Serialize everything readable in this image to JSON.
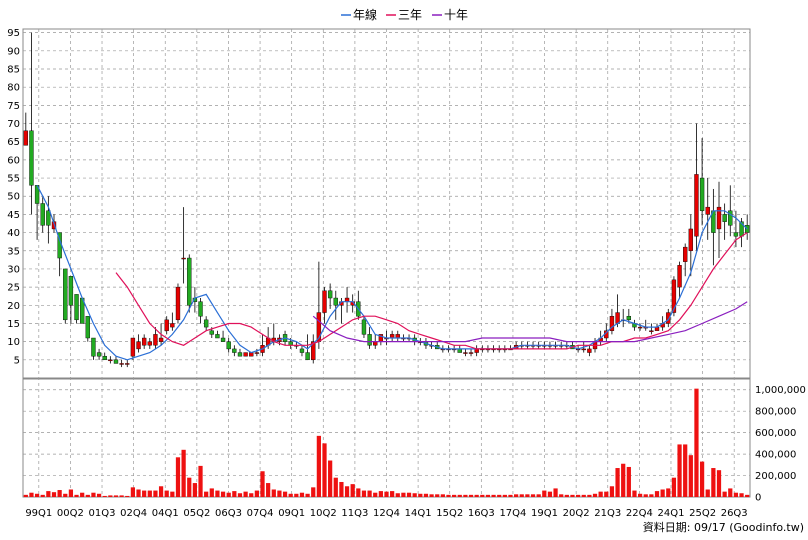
{
  "legend": [
    {
      "label": "年線",
      "color": "#2b6fd6"
    },
    {
      "label": "三年",
      "color": "#e0105a"
    },
    {
      "label": "十年",
      "color": "#8a1fbf"
    }
  ],
  "footer": "資料日期: 09/17  (Goodinfo.tw)",
  "colors": {
    "up": "#e60000",
    "down": "#22aa22",
    "volume": "#ee1111",
    "grid": "#999999",
    "wick": "#000000"
  },
  "chart_data": {
    "type": "candlestick",
    "price_axis": {
      "min": 0,
      "max": 96,
      "ticks": [
        5,
        10,
        15,
        20,
        25,
        30,
        35,
        40,
        45,
        50,
        55,
        60,
        65,
        70,
        75,
        80,
        85,
        90,
        95
      ]
    },
    "volume_axis": {
      "min": 0,
      "max": 1100000,
      "ticks": [
        0,
        200000,
        400000,
        600000,
        800000,
        1000000
      ],
      "tick_labels": [
        "0",
        "200,000",
        "400,000",
        "600,000",
        "800,000",
        "1,000,000"
      ]
    },
    "x_labels": [
      "99Q1",
      "00Q2",
      "01Q3",
      "02Q4",
      "04Q1",
      "05Q2",
      "06Q3",
      "07Q4",
      "09Q1",
      "10Q2",
      "11Q3",
      "12Q4",
      "14Q1",
      "15Q2",
      "16Q3",
      "17Q4",
      "19Q1",
      "20Q2",
      "21Q3",
      "22Q4",
      "24Q1",
      "25Q2",
      "26Q3"
    ],
    "candles": [
      [
        64,
        73,
        64,
        68
      ],
      [
        68,
        95,
        45,
        53
      ],
      [
        53,
        53,
        38,
        48
      ],
      [
        48,
        50,
        40,
        42
      ],
      [
        46,
        50,
        37,
        42
      ],
      [
        41,
        45,
        40,
        43
      ],
      [
        40,
        40,
        28,
        33
      ],
      [
        30,
        30,
        15,
        16
      ],
      [
        28,
        28,
        15,
        20
      ],
      [
        23,
        23,
        15,
        16
      ],
      [
        22,
        22,
        15,
        15
      ],
      [
        17,
        17,
        10,
        11
      ],
      [
        11,
        11,
        5,
        6
      ],
      [
        7,
        8,
        5,
        6
      ],
      [
        6,
        7,
        5,
        5
      ],
      [
        5,
        6,
        4,
        5
      ],
      [
        5,
        6,
        4,
        4
      ],
      [
        4,
        5,
        3,
        4
      ],
      [
        4,
        5,
        3,
        4
      ],
      [
        6,
        11,
        5,
        11
      ],
      [
        8,
        12,
        7,
        10
      ],
      [
        9,
        12,
        8,
        11
      ],
      [
        9,
        11,
        8,
        10
      ],
      [
        9,
        14,
        8,
        12
      ],
      [
        10,
        15,
        9,
        11
      ],
      [
        13,
        17,
        12,
        16
      ],
      [
        14,
        18,
        13,
        15
      ],
      [
        16,
        26,
        15,
        25
      ],
      [
        33,
        47,
        26,
        33
      ],
      [
        33,
        34,
        18,
        20
      ],
      [
        22,
        25,
        18,
        21
      ],
      [
        21,
        22,
        15,
        17
      ],
      [
        16,
        17,
        13,
        14
      ],
      [
        13,
        14,
        11,
        12
      ],
      [
        12,
        13,
        11,
        11
      ],
      [
        11,
        13,
        10,
        10
      ],
      [
        10,
        11,
        7,
        8
      ],
      [
        8,
        9,
        6,
        7
      ],
      [
        7,
        8,
        6,
        6
      ],
      [
        6,
        7,
        6,
        7
      ],
      [
        6,
        7,
        6,
        7
      ],
      [
        7,
        8,
        6,
        7
      ],
      [
        7,
        12,
        6,
        9
      ],
      [
        9,
        14,
        8,
        11
      ],
      [
        10,
        15,
        9,
        11
      ],
      [
        10,
        12,
        9,
        11
      ],
      [
        12,
        13,
        9,
        10
      ],
      [
        10,
        11,
        8,
        9
      ],
      [
        9,
        10,
        8,
        9
      ],
      [
        8,
        9,
        6,
        7
      ],
      [
        7,
        12,
        5,
        5
      ],
      [
        5,
        12,
        4,
        10
      ],
      [
        10,
        32,
        8,
        18
      ],
      [
        18,
        25,
        15,
        24
      ],
      [
        24,
        26,
        19,
        22
      ],
      [
        22,
        24,
        16,
        20
      ],
      [
        20,
        22,
        15,
        21
      ],
      [
        21,
        25,
        18,
        22
      ],
      [
        20,
        23,
        18,
        21
      ],
      [
        21,
        24,
        16,
        17
      ],
      [
        16,
        17,
        11,
        12
      ],
      [
        12,
        14,
        8,
        9
      ],
      [
        9,
        12,
        8,
        10
      ],
      [
        10,
        12,
        9,
        12
      ],
      [
        11,
        13,
        9,
        11
      ],
      [
        11,
        13,
        10,
        12
      ],
      [
        11,
        13,
        10,
        12
      ],
      [
        11,
        12,
        10,
        11
      ],
      [
        11,
        12,
        10,
        11
      ],
      [
        11,
        12,
        9,
        10
      ],
      [
        10,
        11,
        9,
        10
      ],
      [
        10,
        11,
        8,
        9
      ],
      [
        9,
        10,
        8,
        9
      ],
      [
        9,
        10,
        8,
        8
      ],
      [
        8,
        9,
        7,
        8
      ],
      [
        8,
        9,
        7,
        8
      ],
      [
        8,
        9,
        7,
        8
      ],
      [
        8,
        9,
        7,
        7
      ],
      [
        7,
        8,
        6,
        7
      ],
      [
        7,
        8,
        6,
        7
      ],
      [
        7,
        9,
        6,
        8
      ],
      [
        8,
        9,
        7,
        8
      ],
      [
        8,
        9,
        7,
        8
      ],
      [
        8,
        9,
        7,
        8
      ],
      [
        8,
        9,
        7,
        8
      ],
      [
        8,
        9,
        7,
        8
      ],
      [
        8,
        9,
        8,
        8
      ],
      [
        8,
        10,
        8,
        9
      ],
      [
        9,
        10,
        8,
        9
      ],
      [
        9,
        10,
        8,
        9
      ],
      [
        9,
        10,
        8,
        9
      ],
      [
        9,
        10,
        8,
        9
      ],
      [
        9,
        10,
        8,
        9
      ],
      [
        9,
        10,
        8,
        9
      ],
      [
        9,
        10,
        8,
        9
      ],
      [
        9,
        10,
        8,
        9
      ],
      [
        9,
        10,
        8,
        9
      ],
      [
        9,
        10,
        8,
        8
      ],
      [
        8,
        9,
        7,
        8
      ],
      [
        8,
        10,
        7,
        8
      ],
      [
        7,
        9,
        6,
        8
      ],
      [
        8,
        11,
        7,
        10
      ],
      [
        10,
        13,
        9,
        11
      ],
      [
        11,
        15,
        10,
        13
      ],
      [
        13,
        19,
        12,
        17
      ],
      [
        15,
        23,
        14,
        18
      ],
      [
        16,
        19,
        14,
        16
      ],
      [
        17,
        19,
        15,
        16
      ],
      [
        15,
        16,
        13,
        14
      ],
      [
        14,
        15,
        13,
        14
      ],
      [
        14,
        16,
        13,
        14
      ],
      [
        13,
        15,
        12,
        13
      ],
      [
        13,
        15,
        13,
        14
      ],
      [
        14,
        17,
        13,
        15
      ],
      [
        15,
        19,
        14,
        18
      ],
      [
        18,
        28,
        17,
        27
      ],
      [
        25,
        32,
        22,
        31
      ],
      [
        32,
        37,
        28,
        36
      ],
      [
        35,
        45,
        28,
        41
      ],
      [
        39,
        70,
        35,
        56
      ],
      [
        55,
        66,
        42,
        46
      ],
      [
        45,
        55,
        38,
        47
      ],
      [
        46,
        52,
        31,
        40
      ],
      [
        41,
        54,
        33,
        47
      ],
      [
        45,
        48,
        38,
        43
      ],
      [
        46,
        53,
        39,
        42
      ],
      [
        40,
        46,
        36,
        39
      ],
      [
        43,
        44,
        36,
        39
      ],
      [
        42,
        45,
        38,
        40
      ]
    ],
    "volume": [
      20000,
      40000,
      30000,
      20000,
      55000,
      45000,
      65000,
      30000,
      70000,
      20000,
      40000,
      20000,
      40000,
      30000,
      10000,
      15000,
      15000,
      15000,
      10000,
      90000,
      70000,
      60000,
      60000,
      60000,
      100000,
      60000,
      50000,
      370000,
      440000,
      180000,
      130000,
      290000,
      50000,
      80000,
      60000,
      50000,
      40000,
      55000,
      35000,
      50000,
      35000,
      60000,
      240000,
      130000,
      70000,
      60000,
      50000,
      30000,
      30000,
      40000,
      30000,
      90000,
      570000,
      500000,
      340000,
      180000,
      140000,
      100000,
      120000,
      80000,
      60000,
      60000,
      40000,
      55000,
      50000,
      55000,
      35000,
      40000,
      40000,
      35000,
      30000,
      30000,
      25000,
      25000,
      25000,
      20000,
      20000,
      20000,
      20000,
      20000,
      20000,
      20000,
      20000,
      20000,
      20000,
      20000,
      20000,
      25000,
      25000,
      25000,
      25000,
      25000,
      60000,
      50000,
      80000,
      25000,
      20000,
      20000,
      20000,
      20000,
      20000,
      30000,
      50000,
      50000,
      100000,
      270000,
      310000,
      280000,
      60000,
      30000,
      25000,
      25000,
      55000,
      70000,
      80000,
      180000,
      490000,
      490000,
      390000,
      1010000,
      330000,
      70000,
      270000,
      250000,
      50000,
      80000,
      40000,
      35000,
      20000
    ],
    "series": [
      {
        "name": "年線",
        "color": "#2b6fd6",
        "points": [
          [
            2,
            53
          ],
          [
            4,
            47
          ],
          [
            6,
            38
          ],
          [
            8,
            30
          ],
          [
            10,
            22
          ],
          [
            12,
            15
          ],
          [
            14,
            9
          ],
          [
            16,
            6
          ],
          [
            18,
            5
          ],
          [
            20,
            6
          ],
          [
            22,
            7
          ],
          [
            24,
            9
          ],
          [
            26,
            12
          ],
          [
            28,
            16
          ],
          [
            30,
            22
          ],
          [
            32,
            23
          ],
          [
            34,
            18
          ],
          [
            36,
            13
          ],
          [
            38,
            9
          ],
          [
            40,
            7
          ],
          [
            42,
            8
          ],
          [
            44,
            10
          ],
          [
            46,
            11
          ],
          [
            48,
            10
          ],
          [
            50,
            8
          ],
          [
            52,
            11
          ],
          [
            54,
            17
          ],
          [
            56,
            21
          ],
          [
            58,
            21
          ],
          [
            60,
            17
          ],
          [
            62,
            12
          ],
          [
            64,
            11
          ],
          [
            66,
            11
          ],
          [
            68,
            11
          ],
          [
            70,
            10
          ],
          [
            72,
            9
          ],
          [
            74,
            8
          ],
          [
            76,
            8
          ],
          [
            78,
            8
          ],
          [
            80,
            8
          ],
          [
            82,
            8
          ],
          [
            84,
            8
          ],
          [
            86,
            8
          ],
          [
            88,
            9
          ],
          [
            90,
            9
          ],
          [
            92,
            9
          ],
          [
            94,
            9
          ],
          [
            96,
            9
          ],
          [
            98,
            8
          ],
          [
            100,
            9
          ],
          [
            102,
            11
          ],
          [
            104,
            14
          ],
          [
            106,
            16
          ],
          [
            108,
            15
          ],
          [
            110,
            14
          ],
          [
            112,
            14
          ],
          [
            114,
            16
          ],
          [
            116,
            22
          ],
          [
            118,
            29
          ],
          [
            120,
            40
          ],
          [
            122,
            46
          ],
          [
            124,
            46
          ],
          [
            126,
            44
          ],
          [
            128,
            41
          ]
        ]
      },
      {
        "name": "三年",
        "color": "#e0105a",
        "points": [
          [
            16,
            29
          ],
          [
            18,
            25
          ],
          [
            20,
            20
          ],
          [
            22,
            15
          ],
          [
            24,
            12
          ],
          [
            26,
            10
          ],
          [
            28,
            9
          ],
          [
            30,
            11
          ],
          [
            32,
            13
          ],
          [
            34,
            14
          ],
          [
            36,
            15
          ],
          [
            38,
            15
          ],
          [
            40,
            14
          ],
          [
            42,
            12
          ],
          [
            44,
            10
          ],
          [
            46,
            9
          ],
          [
            48,
            9
          ],
          [
            50,
            9
          ],
          [
            52,
            10
          ],
          [
            54,
            12
          ],
          [
            56,
            14
          ],
          [
            58,
            16
          ],
          [
            60,
            17
          ],
          [
            62,
            17
          ],
          [
            64,
            16
          ],
          [
            66,
            15
          ],
          [
            68,
            13
          ],
          [
            70,
            12
          ],
          [
            72,
            11
          ],
          [
            74,
            10
          ],
          [
            76,
            9
          ],
          [
            78,
            9
          ],
          [
            80,
            8
          ],
          [
            82,
            8
          ],
          [
            84,
            8
          ],
          [
            86,
            8
          ],
          [
            88,
            8
          ],
          [
            90,
            8
          ],
          [
            92,
            8
          ],
          [
            94,
            8
          ],
          [
            96,
            8
          ],
          [
            98,
            9
          ],
          [
            100,
            9
          ],
          [
            102,
            9
          ],
          [
            104,
            10
          ],
          [
            106,
            10
          ],
          [
            108,
            11
          ],
          [
            110,
            11
          ],
          [
            112,
            12
          ],
          [
            114,
            13
          ],
          [
            116,
            16
          ],
          [
            118,
            20
          ],
          [
            120,
            25
          ],
          [
            122,
            30
          ],
          [
            124,
            34
          ],
          [
            126,
            38
          ],
          [
            128,
            40
          ]
        ]
      },
      {
        "name": "十年",
        "color": "#8a1fbf",
        "points": [
          [
            51,
            17
          ],
          [
            54,
            13
          ],
          [
            57,
            11
          ],
          [
            60,
            10
          ],
          [
            63,
            10
          ],
          [
            66,
            10
          ],
          [
            69,
            10
          ],
          [
            72,
            10
          ],
          [
            75,
            10
          ],
          [
            78,
            10
          ],
          [
            81,
            11
          ],
          [
            84,
            11
          ],
          [
            87,
            11
          ],
          [
            90,
            11
          ],
          [
            93,
            11
          ],
          [
            96,
            10
          ],
          [
            99,
            10
          ],
          [
            102,
            10
          ],
          [
            105,
            10
          ],
          [
            108,
            10
          ],
          [
            111,
            11
          ],
          [
            114,
            12
          ],
          [
            117,
            13
          ],
          [
            120,
            15
          ],
          [
            123,
            17
          ],
          [
            126,
            19
          ],
          [
            128,
            21
          ]
        ]
      }
    ]
  }
}
